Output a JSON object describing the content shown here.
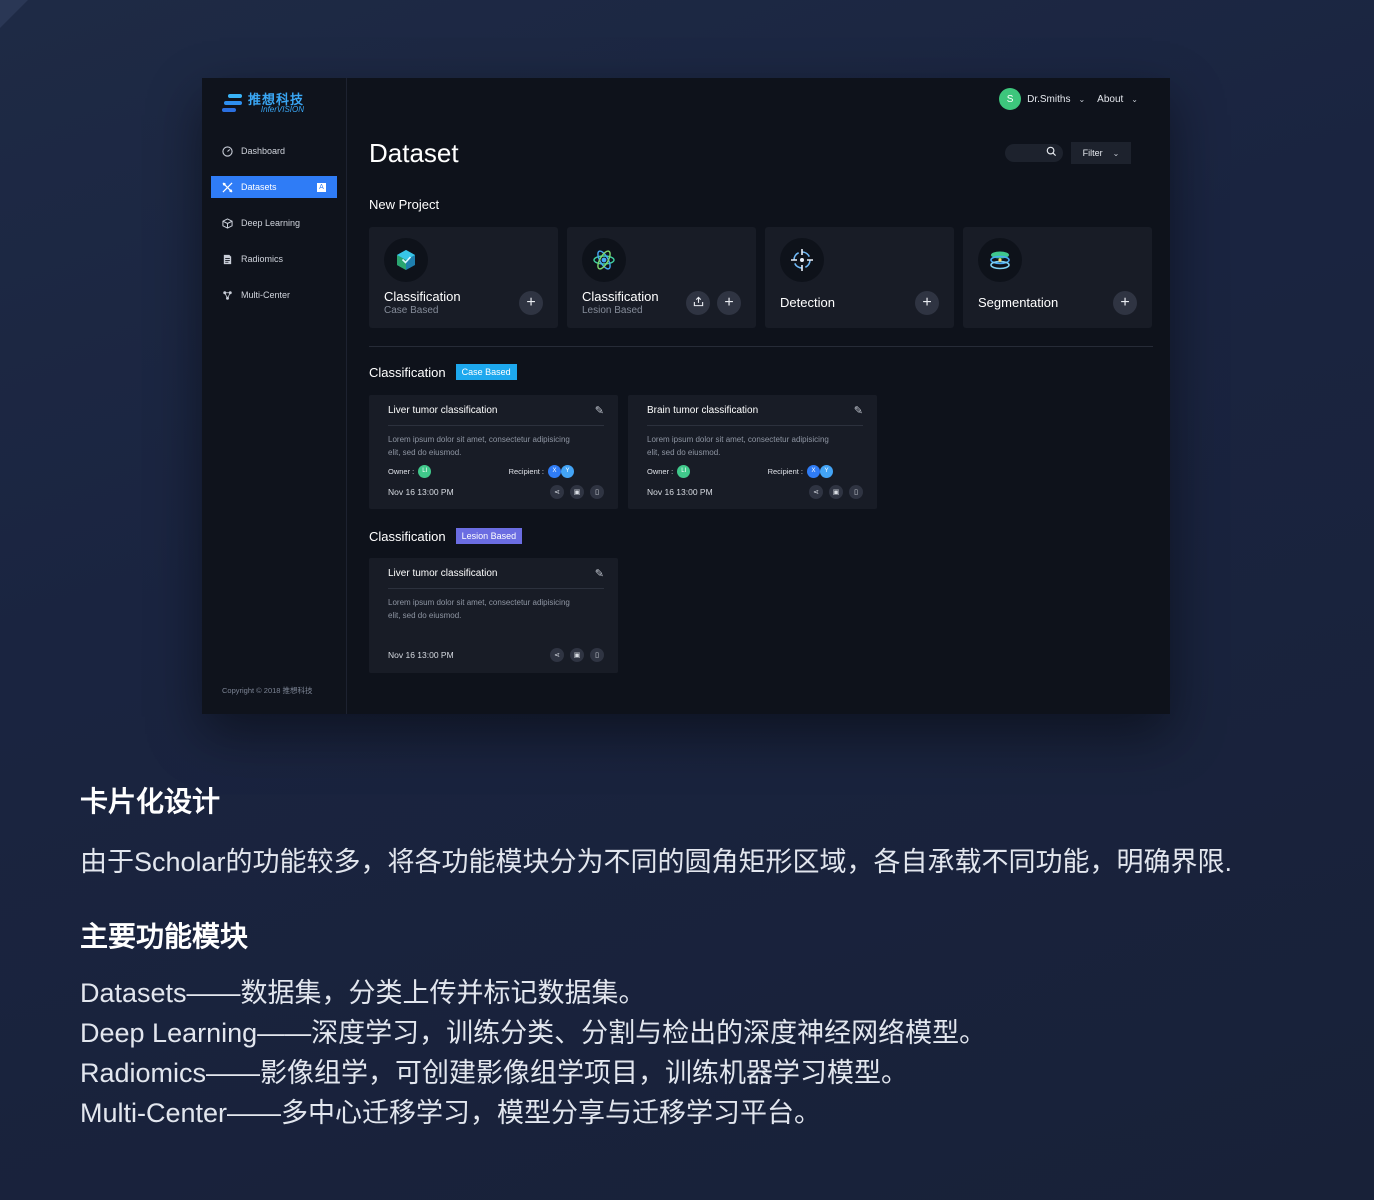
{
  "app": {
    "logo": {
      "cn": "推想科技",
      "en": "InferVISION"
    },
    "sidebar": {
      "items": [
        {
          "label": "Dashboard",
          "icon": "dashboard-gauge-icon",
          "active": false
        },
        {
          "label": "Datasets",
          "icon": "datasets-tools-icon",
          "active": true,
          "badge": "A"
        },
        {
          "label": "Deep Learning",
          "icon": "cube-icon",
          "active": false
        },
        {
          "label": "Radiomics",
          "icon": "document-icon",
          "active": false
        },
        {
          "label": "Multi-Center",
          "icon": "network-icon",
          "active": false
        }
      ],
      "copyright": "Copyright © 2018 推想科技"
    },
    "topbar": {
      "avatar_initial": "S",
      "user_name": "Dr.Smiths",
      "about_label": "About"
    },
    "page_title": "Dataset",
    "filter_label": "Filter",
    "new_project": {
      "label": "New Project",
      "cards": [
        {
          "title": "Classification",
          "subtitle": "Case Based",
          "icon": "box-icon"
        },
        {
          "title": "Classification",
          "subtitle": "Lesion Based",
          "icon": "atom-icon"
        },
        {
          "title": "Detection",
          "subtitle": "",
          "icon": "crosshair-icon"
        },
        {
          "title": "Segmentation",
          "subtitle": "",
          "icon": "layers-icon"
        }
      ]
    },
    "groups": [
      {
        "title": "Classification",
        "tag": "Case Based",
        "cards": [
          {
            "title": "Liver tumor classification",
            "desc": "Lorem ipsum dolor sit amet, consectetur adipisicing elit, sed do eiusmod.",
            "owner_label": "Owner :",
            "owner": "LI",
            "recipient_label": "Recipient :",
            "recipients": [
              "X",
              "Y"
            ],
            "date": "Nov 16 13:00 PM"
          },
          {
            "title": "Brain tumor classification",
            "desc": "Lorem ipsum dolor sit amet, consectetur adipisicing elit, sed do eiusmod.",
            "owner_label": "Owner :",
            "owner": "LI",
            "recipient_label": "Recipient :",
            "recipients": [
              "X",
              "Y"
            ],
            "date": "Nov 16 13:00 PM"
          }
        ]
      },
      {
        "title": "Classification",
        "tag": "Lesion Based",
        "cards": [
          {
            "title": "Liver tumor classification",
            "desc": "Lorem ipsum dolor sit amet, consectetur adipisicing elit, sed do eiusmod.",
            "date": "Nov 16 13:00 PM"
          }
        ]
      }
    ]
  },
  "article": {
    "heading1": "卡片化设计",
    "para1": "由于Scholar的功能较多，将各功能模块分为不同的圆角矩形区域，各自承载不同功能，明确界限.",
    "heading2": "主要功能模块",
    "list": [
      "Datasets——数据集，分类上传并标记数据集。",
      "Deep Learning——深度学习，训练分类、分割与检出的深度神经网络模型。",
      "Radiomics——影像组学，可创建影像组学项目，训练机器学习模型。",
      "Multi-Center——多中心迁移学习，模型分享与迁移学习平台。"
    ]
  },
  "colors": {
    "accent": "#2f7cf6",
    "case_tag": "#1da8ee",
    "lesion_tag": "#6b6de2",
    "avatar": "#3dc67c"
  }
}
